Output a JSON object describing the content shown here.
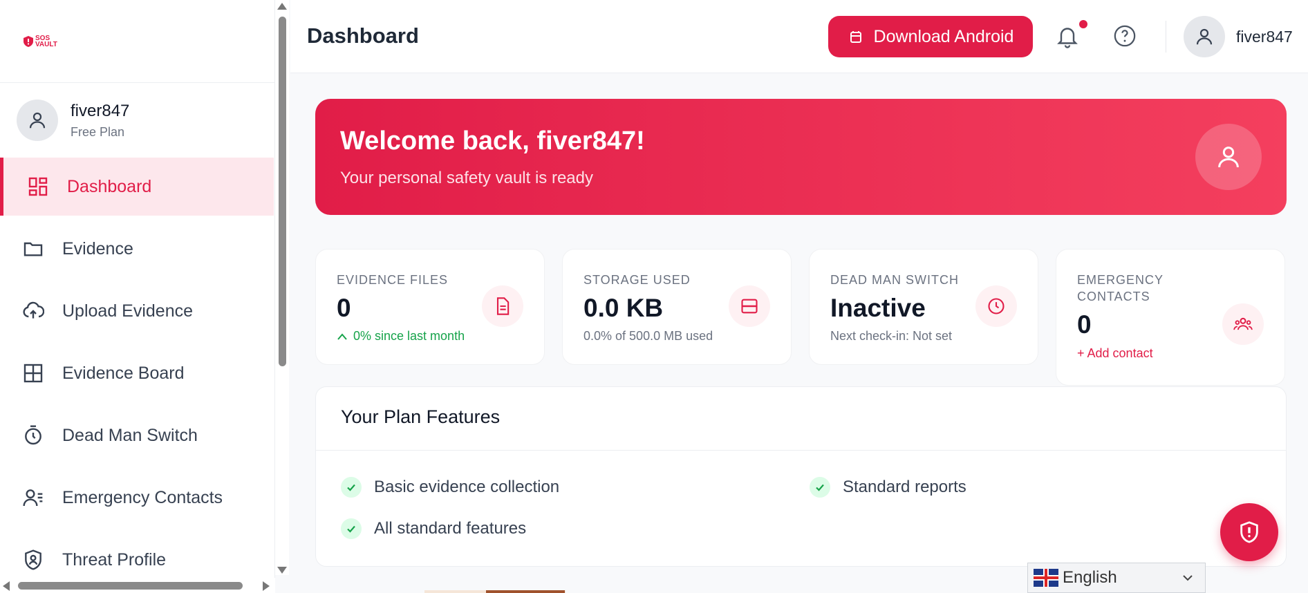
{
  "app": {
    "logo_text_line1": "SOS",
    "logo_text_line2": "VAULT"
  },
  "sidebar": {
    "user": {
      "name": "fiver847",
      "plan": "Free Plan"
    },
    "items": [
      {
        "label": "Dashboard",
        "icon": "dashboard-icon",
        "active": true
      },
      {
        "label": "Evidence",
        "icon": "folder-icon"
      },
      {
        "label": "Upload Evidence",
        "icon": "cloud-upload-icon"
      },
      {
        "label": "Evidence Board",
        "icon": "grid-icon"
      },
      {
        "label": "Dead Man Switch",
        "icon": "timer-icon"
      },
      {
        "label": "Emergency Contacts",
        "icon": "contacts-icon"
      },
      {
        "label": "Threat Profile",
        "icon": "shield-user-icon"
      }
    ]
  },
  "header": {
    "title": "Dashboard",
    "download_button": "Download Android",
    "username": "fiver847"
  },
  "welcome": {
    "title": "Welcome back, fiver847!",
    "subtitle": "Your personal safety vault is ready"
  },
  "stats": [
    {
      "label": "EVIDENCE FILES",
      "value": "0",
      "sub": "0% since last month",
      "icon": "document-icon"
    },
    {
      "label": "STORAGE USED",
      "value": "0.0 KB",
      "sub": "0.0% of 500.0 MB used",
      "icon": "storage-icon"
    },
    {
      "label": "DEAD MAN SWITCH",
      "value": "Inactive",
      "sub": "Next check-in: Not set",
      "icon": "clock-icon"
    },
    {
      "label_line1": "EMERGENCY",
      "label_line2": "CONTACTS",
      "value": "0",
      "sub": "+ Add contact",
      "icon": "group-icon"
    }
  ],
  "plan": {
    "title": "Your Plan Features",
    "features": [
      "Basic evidence collection",
      "Standard reports",
      "All standard features"
    ]
  },
  "language": {
    "selected": "English"
  },
  "colors": {
    "accent": "#e11d48",
    "success": "#16a34a"
  }
}
